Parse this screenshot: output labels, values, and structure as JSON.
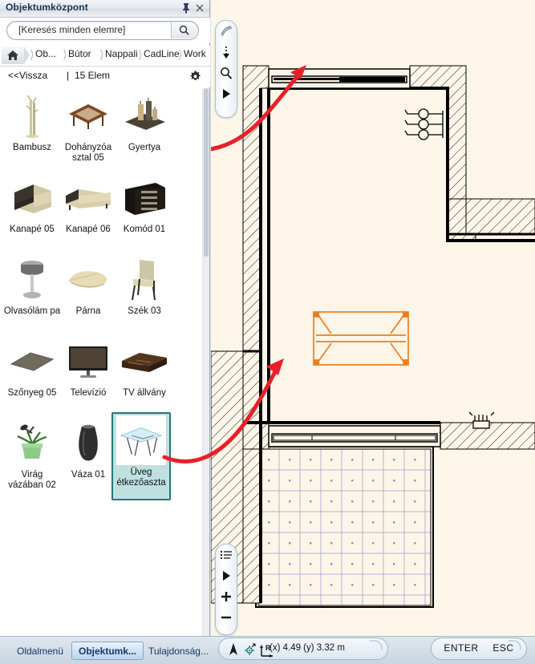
{
  "panel": {
    "title": "Objektumközpont",
    "pin_icon": "pin-icon",
    "close_icon": "close-icon"
  },
  "search": {
    "placeholder": "[Keresés minden elemre]",
    "value": "[Keresés minden elemre]",
    "icon": "search-icon"
  },
  "breadcrumb": {
    "home_icon": "home-icon",
    "items": [
      {
        "label": "Ob..."
      },
      {
        "label": "Bútor"
      },
      {
        "label": "Nappali"
      },
      {
        "label": "CadLine"
      },
      {
        "label": "Work"
      }
    ]
  },
  "subbar": {
    "back_label": "<<Vissza",
    "separator": "|",
    "count_label": "15 Elem",
    "settings_icon": "gear-icon"
  },
  "items": [
    {
      "name": "Bambusz",
      "icon": "bamboo-icon",
      "selected": false
    },
    {
      "name": "Dohányzóa sztal 05",
      "icon": "coffee-table-icon",
      "selected": false
    },
    {
      "name": "Gyertya",
      "icon": "candle-icon",
      "selected": false
    },
    {
      "name": "Kanapé 05",
      "icon": "armchair-icon",
      "selected": false
    },
    {
      "name": "Kanapé 06",
      "icon": "sofa-icon",
      "selected": false
    },
    {
      "name": "Komód 01",
      "icon": "dresser-icon",
      "selected": false
    },
    {
      "name": "Olvasólám pa",
      "icon": "floor-lamp-icon",
      "selected": false
    },
    {
      "name": "Párna",
      "icon": "pillow-icon",
      "selected": false
    },
    {
      "name": "Szék 03",
      "icon": "chair-icon",
      "selected": false
    },
    {
      "name": "Szőnyeg 05",
      "icon": "rug-icon",
      "selected": false
    },
    {
      "name": "Televízió",
      "icon": "tv-icon",
      "selected": false
    },
    {
      "name": "TV állvány",
      "icon": "tv-stand-icon",
      "selected": false
    },
    {
      "name": "Virág vázában 02",
      "icon": "potted-plant-icon",
      "selected": false
    },
    {
      "name": "Váza 01",
      "icon": "vase-icon",
      "selected": false
    },
    {
      "name": "Üveg étkezőaszta",
      "icon": "glass-table-icon",
      "selected": true
    }
  ],
  "canvas": {
    "left_toolbar_top": [
      {
        "icon": "sweep-arc-icon"
      },
      {
        "icon": "move-down-icon"
      },
      {
        "icon": "zoom-icon"
      },
      {
        "icon": "play-next-icon"
      }
    ],
    "left_toolbar_bottom": [
      {
        "icon": "list-icon"
      },
      {
        "icon": "play-next-icon"
      },
      {
        "icon": "zoom-in-icon"
      },
      {
        "icon": "zoom-out-icon"
      }
    ],
    "placed_object": {
      "name": "glass-dining-table",
      "color": "#ef7d1a"
    },
    "annotation_arrow": {
      "name": "drag-drop-arrow",
      "color": "#e8202a"
    },
    "colors": {
      "background": "#fdf6e8",
      "wall_line": "#000000",
      "tile_grid": "#aeb4d8"
    }
  },
  "bottom_tabs": [
    {
      "label": "Oldalmenü",
      "active": false
    },
    {
      "label": "Objektumk...",
      "active": true
    },
    {
      "label": "Tulajdonság...",
      "active": false
    }
  ],
  "status": {
    "nav_icon": "compass-icon",
    "snap_icon": "snap-point-icon",
    "axis_icon": "relative-axis-icon",
    "coords": "(x) 4.49   (y) 3.32 m",
    "enter_label": "ENTER",
    "esc_label": "ESC"
  }
}
